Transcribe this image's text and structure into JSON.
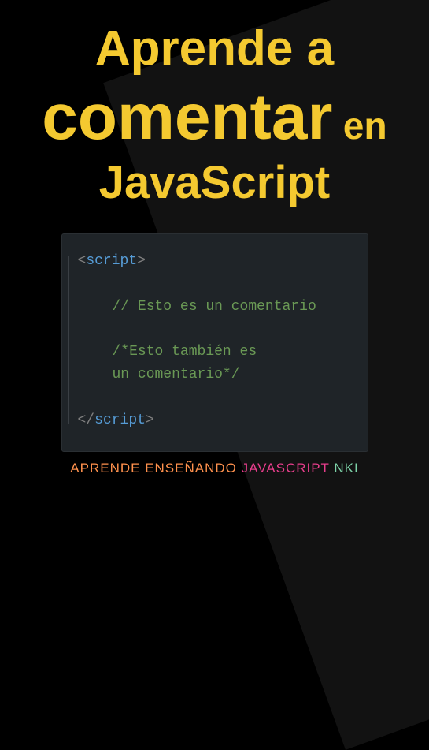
{
  "title": {
    "line1": "Aprende a",
    "line2_big": "comentar",
    "line2_small": " en",
    "line3": "JavaScript"
  },
  "code": {
    "open_bracket1": "<",
    "open_tag": "script",
    "open_bracket2": ">",
    "comment1": "// Esto es un comentario",
    "comment2a": "/*Esto también es",
    "comment2b": "un comentario*/",
    "close_bracket1": "</",
    "close_tag": "script",
    "close_bracket2": ">"
  },
  "footer": {
    "part1": "APRENDE ENSEÑANDO ",
    "part2": "JAVASCRIPT ",
    "part3": "NKI"
  }
}
